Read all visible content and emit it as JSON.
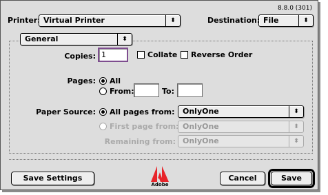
{
  "dialog": {
    "version": "8.8.0 (301)",
    "printer_label": "Printer:",
    "printer_value": "Virtual Printer",
    "destination_label": "Destination:",
    "destination_value": "File",
    "panel_value": "General"
  },
  "copies": {
    "label": "Copies:",
    "value": "1",
    "collate_label": "Collate",
    "collate_checked": false,
    "reverse_label": "Reverse Order",
    "reverse_checked": false
  },
  "pages": {
    "label": "Pages:",
    "all_label": "All",
    "all_selected": true,
    "from_label": "From:",
    "from_value": "",
    "to_label": "To:",
    "to_value": ""
  },
  "paper_source": {
    "label": "Paper Source:",
    "all_pages_label": "All pages from:",
    "all_pages_value": "OnlyOne",
    "first_page_label": "First page from:",
    "first_page_value": "OnlyOne",
    "remaining_label": "Remaining from:",
    "remaining_value": "OnlyOne"
  },
  "buttons": {
    "save_settings": "Save Settings",
    "cancel": "Cancel",
    "save": "Save"
  },
  "logo": {
    "icon": "adobe-logo-icon",
    "text": "Adobe",
    "color": "#e8242a"
  },
  "glyphs": {
    "popup_arrows": "⬍"
  }
}
